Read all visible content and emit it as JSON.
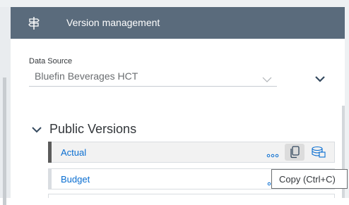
{
  "header": {
    "title": "Version management",
    "icon": "signpost-icon"
  },
  "data_source": {
    "label": "Data Source",
    "selected": "Bluefin Beverages HCT"
  },
  "section": {
    "title": "Public Versions"
  },
  "versions": [
    {
      "label": "Actual",
      "bar_color": "#5b5b5b",
      "selected": true
    },
    {
      "label": "Budget",
      "bar_color": "#d9dde1",
      "selected": false
    }
  ],
  "tooltip": {
    "text": "Copy (Ctrl+C)"
  },
  "colors": {
    "header_bg": "#5a6b7c",
    "link": "#0a6ed1",
    "accent": "#0a6ed1"
  }
}
